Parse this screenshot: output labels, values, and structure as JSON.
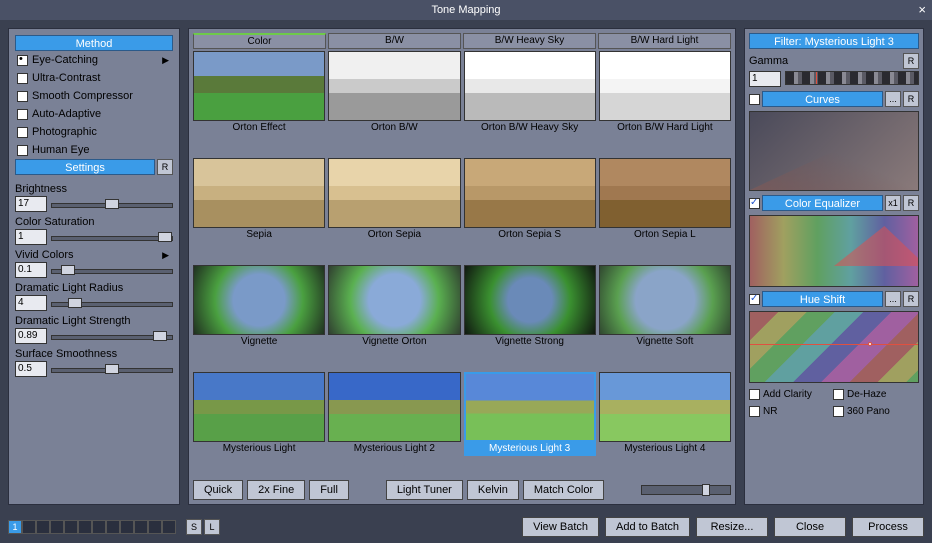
{
  "title": "Tone Mapping",
  "left": {
    "method_header": "Method",
    "methods": [
      "Eye-Catching",
      "Ultra-Contrast",
      "Smooth Compressor",
      "Auto-Adaptive",
      "Photographic",
      "Human Eye"
    ],
    "selected_method": 0,
    "settings_header": "Settings",
    "reset": "R",
    "sliders": [
      {
        "label": "Brightness",
        "value": "17",
        "pos": 44
      },
      {
        "label": "Color Saturation",
        "value": "1",
        "pos": 88
      },
      {
        "label": "Vivid Colors",
        "value": "0.1",
        "pos": 8,
        "arrow": true
      },
      {
        "label": "Dramatic Light Radius",
        "value": "4",
        "pos": 14
      },
      {
        "label": "Dramatic Light Strength",
        "value": "0.89",
        "pos": 84
      },
      {
        "label": "Surface Smoothness",
        "value": "0.5",
        "pos": 44
      }
    ]
  },
  "mid": {
    "tabs": [
      "Color",
      "B/W",
      "B/W Heavy Sky",
      "B/W Hard Light"
    ],
    "active_tab": 0,
    "presets": [
      "Orton Effect",
      "Orton B/W",
      "Orton B/W Heavy Sky",
      "Orton B/W Hard Light",
      "Sepia",
      "Orton Sepia",
      "Orton Sepia S",
      "Orton Sepia L",
      "Vignette",
      "Vignette Orton",
      "Vignette Strong",
      "Vignette Soft",
      "Mysterious Light",
      "Mysterious Light 2",
      "Mysterious Light 3",
      "Mysterious Light 4"
    ],
    "selected_preset": 14,
    "btns_left": [
      "Quick",
      "2x Fine",
      "Full"
    ],
    "btns_center": [
      "Light Tuner",
      "Kelvin",
      "Match Color"
    ]
  },
  "right": {
    "filter_header": "Filter: Mysterious Light 3",
    "gamma_label": "Gamma",
    "gamma_value": "1",
    "curves_header": "Curves",
    "coloreq_header": "Color Equalizer",
    "x1": "x1",
    "hueshift_header": "Hue Shift",
    "dots": "...",
    "reset": "R",
    "checks": [
      "Add Clarity",
      "De-Haze",
      "NR",
      "360 Pano"
    ]
  },
  "footer": {
    "page": "1",
    "sl": [
      "S",
      "L"
    ],
    "btns": [
      "View Batch",
      "Add to Batch",
      "Resize...",
      "Close",
      "Process"
    ]
  }
}
